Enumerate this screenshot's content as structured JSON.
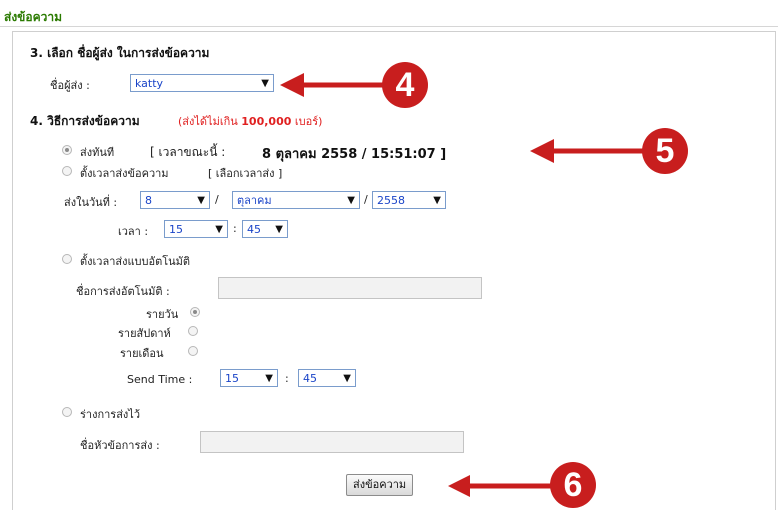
{
  "header": {
    "title": "ส่งข้อความ"
  },
  "sender_section": {
    "heading": "3. เลือก ชื่อผู้ส่ง ในการส่งข้อความ",
    "label": "ชื่อผู้ส่ง :",
    "value": "katty"
  },
  "method_section": {
    "heading": "4. วิธีการส่งข้อความ",
    "note_prefix": "(ส่งได้ไม่เกิน ",
    "note_limit": "100,000",
    "note_suffix": " เบอร์)",
    "send_now": {
      "label": "ส่งทันที",
      "time_prefix": "[ เวลาขณะนี้ :",
      "time_value": "8 ตุลาคม 2558 / 15:51:07 ]",
      "selected": true
    },
    "schedule": {
      "label": "ตั้งเวลาส่งข้อความ",
      "link": "[ เลือกเวลาส่ง ]",
      "date_label": "ส่งในวันที่ :",
      "day": "8",
      "month": "ตุลาคม",
      "year": "2558",
      "separator": "/",
      "time_label": "เวลา :",
      "hour": "15",
      "minute": "45",
      "colon": ":"
    },
    "auto": {
      "label": "ตั้งเวลาส่งแบบอัตโนมัติ",
      "name_label": "ชื่อการส่งอัตโนมัติ :",
      "name_value": "",
      "daily": "รายวัน",
      "weekly": "รายสัปดาห์",
      "monthly": "รายเดือน",
      "send_time_label": "Send Time :",
      "hour": "15",
      "minute": "45",
      "colon": ":"
    },
    "draft": {
      "label": "ร่างการส่งไว้",
      "subject_label": "ชื่อหัวข้อการส่ง :",
      "subject_value": ""
    }
  },
  "submit": {
    "label": "ส่งข้อความ"
  },
  "annotations": {
    "badge_4": "4",
    "badge_5": "5",
    "badge_6": "6",
    "color": "#c81e1e"
  }
}
